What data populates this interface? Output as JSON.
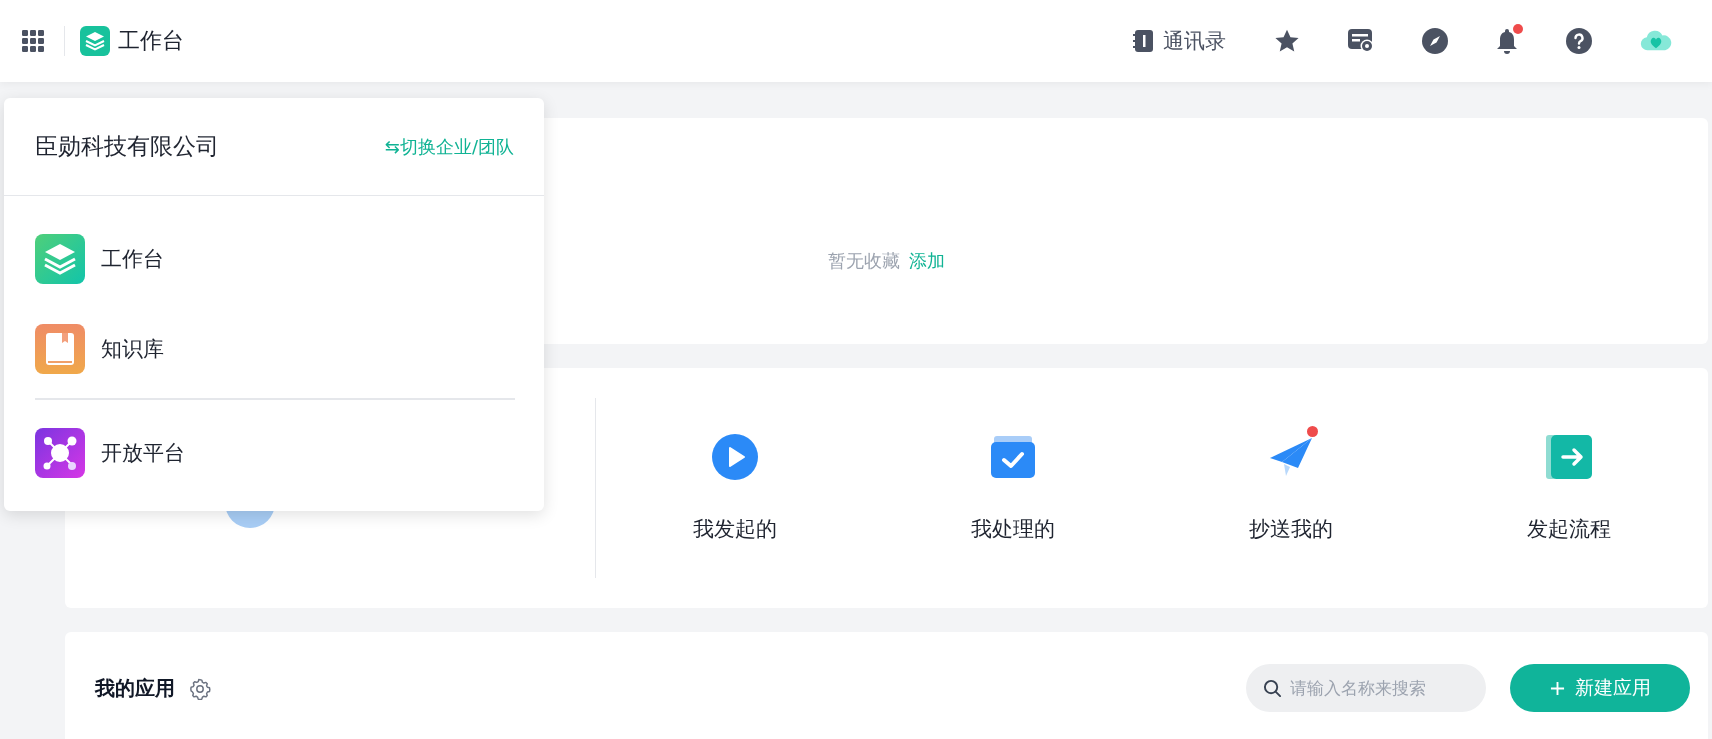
{
  "topbar": {
    "title": "工作台",
    "contacts": "通讯录",
    "notification_badge": true
  },
  "dropdown": {
    "company": "臣勋科技有限公司",
    "switch_link": "⇆切换企业/团队",
    "items": [
      {
        "label": "工作台",
        "kind": "workbench",
        "divider_before": false
      },
      {
        "label": "知识库",
        "kind": "knowledge",
        "divider_before": false
      },
      {
        "label": "开放平台",
        "kind": "platform",
        "divider_before": true
      }
    ]
  },
  "favorites": {
    "empty_text": "暂无收藏",
    "add_link": "添加"
  },
  "actions": [
    {
      "label": "我发起的",
      "kind": "started",
      "badge": false
    },
    {
      "label": "我处理的",
      "kind": "handled",
      "badge": false
    },
    {
      "label": "抄送我的",
      "kind": "cc",
      "badge": true
    },
    {
      "label": "发起流程",
      "kind": "launch",
      "badge": false
    }
  ],
  "apps": {
    "title": "我的应用",
    "search_placeholder": "请输入名称来搜索",
    "new_button": "新建应用"
  }
}
